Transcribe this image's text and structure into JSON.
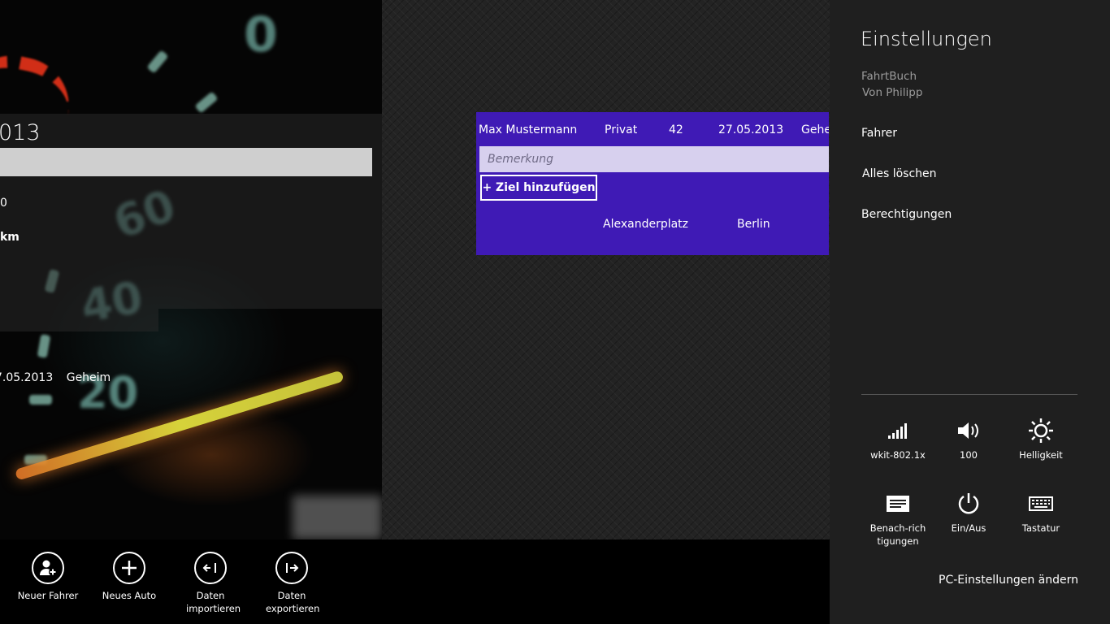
{
  "left_panel": {
    "date_fragment": "013",
    "line1": "0",
    "line2": "km",
    "row": [
      "7.05.2013",
      "Geheim"
    ]
  },
  "trip_card": {
    "driver": "Max Mustermann",
    "type": "Privat",
    "number": "42",
    "date": "27.05.2013",
    "status": "Gehe",
    "remark_placeholder": "Bemerkung",
    "add_goal_label": "+ Ziel hinzufügen",
    "destination_street": "Alexanderplatz",
    "destination_city": "Berlin"
  },
  "appbar": {
    "buttons": [
      {
        "label": "Neuer Fahrer",
        "icon": "add-user-icon"
      },
      {
        "label": "Neues Auto",
        "icon": "plus-icon"
      },
      {
        "label": "Daten importieren",
        "icon": "import-icon"
      },
      {
        "label": "Daten exportieren",
        "icon": "export-icon"
      }
    ]
  },
  "settings_charm": {
    "title": "Einstellungen",
    "app_name": "FahrtBuch",
    "publisher": "Von Philipp",
    "links": [
      "Fahrer",
      "Alles löschen",
      "Berechtigungen"
    ],
    "quick_settings": [
      {
        "label": "wkit-802.1x",
        "icon": "wifi-signal-icon"
      },
      {
        "label": "100",
        "icon": "volume-icon"
      },
      {
        "label": "Helligkeit",
        "icon": "brightness-icon"
      },
      {
        "label": "Benach-richtigungen",
        "icon": "notifications-icon"
      },
      {
        "label": "Ein/Aus",
        "icon": "power-icon"
      },
      {
        "label": "Tastatur",
        "icon": "keyboard-icon"
      }
    ],
    "pc_settings_link": "PC-Einstellungen ändern"
  },
  "colors": {
    "card_purple": "#3f1ab5",
    "charm_background": "#1f1f1f",
    "appbar_background": "#000000"
  }
}
